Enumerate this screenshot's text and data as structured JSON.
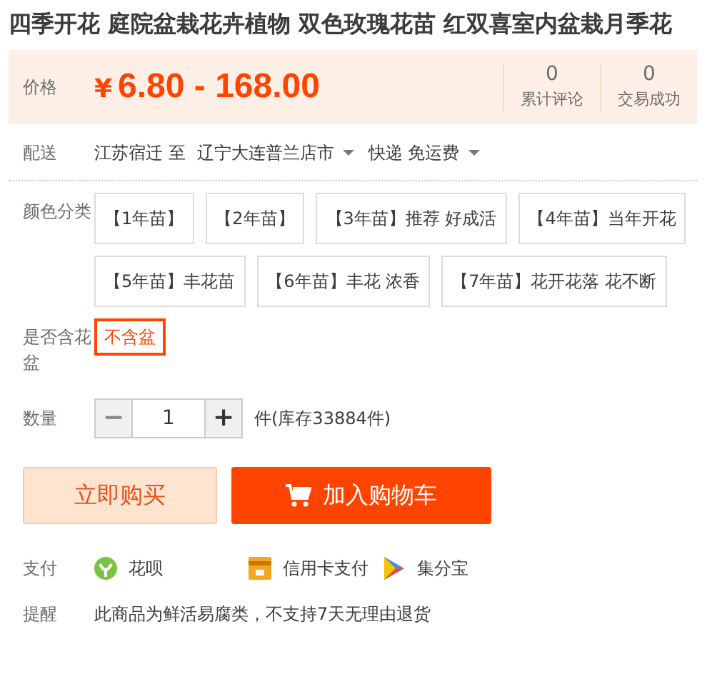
{
  "title": "四季开花 庭院盆栽花卉植物 双色玫瑰花苗 红双喜室内盆栽月季花",
  "price": {
    "label": "价格",
    "currency": "¥",
    "amount": "6.80 - 168.00"
  },
  "stats": [
    {
      "value": "0",
      "label": "累计评论"
    },
    {
      "value": "0",
      "label": "交易成功"
    }
  ],
  "delivery": {
    "label": "配送",
    "from": "江苏宿迁 至",
    "to": "辽宁大连普兰店市",
    "shipping": "快递 免运费"
  },
  "options": [
    {
      "label": "颜色分类",
      "choices": [
        {
          "text": "【1年苗】",
          "selected": false
        },
        {
          "text": "【2年苗】",
          "selected": false
        },
        {
          "text": "【3年苗】推荐 好成活",
          "selected": false
        },
        {
          "text": "【4年苗】当年开花",
          "selected": false
        },
        {
          "text": "【5年苗】丰花苗",
          "selected": false
        },
        {
          "text": "【6年苗】丰花 浓香",
          "selected": false
        },
        {
          "text": "【7年苗】花开花落 花不断",
          "selected": false
        }
      ]
    },
    {
      "label": "是否含花盆",
      "choices": [
        {
          "text": "不含盆",
          "selected": true
        }
      ]
    }
  ],
  "quantity": {
    "label": "数量",
    "minus": "−",
    "minus_disabled": true,
    "value": "1",
    "plus": "+",
    "stock": "件(库存33884件)"
  },
  "buttons": [
    {
      "kind": "buy",
      "text": "立即购买"
    },
    {
      "kind": "cart",
      "text": "加入购物车"
    }
  ],
  "payment": {
    "label": "支付",
    "methods": [
      {
        "kind": "huabei",
        "text": "花呗"
      },
      {
        "kind": "card",
        "text": "信用卡支付"
      },
      {
        "kind": "jifenbao",
        "text": "集分宝"
      }
    ]
  },
  "reminder": {
    "label": "提醒",
    "text": "此商品为鲜活易腐类，不支持7天无理由退货"
  }
}
